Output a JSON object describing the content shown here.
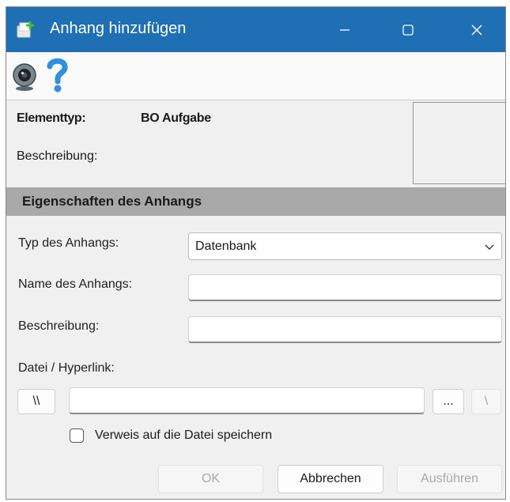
{
  "window": {
    "title": "Anhang hinzufügen"
  },
  "titlebar": {
    "minimize": "minimize-icon",
    "maximize": "maximize-icon",
    "close": "close-icon"
  },
  "toolbar": {
    "icons": [
      "webcam-icon",
      "help-icon"
    ]
  },
  "info": {
    "element_type_label": "Elementtyp:",
    "element_type_value": "BO Aufgabe",
    "description_label": "Beschreibung:"
  },
  "section": {
    "title": "Eigenschaften des Anhangs"
  },
  "form": {
    "type_label": "Typ des Anhangs:",
    "type_value": "Datenbank",
    "name_label": "Name des Anhangs:",
    "name_value": "",
    "description_label": "Beschreibung:",
    "description_value": "",
    "file_label": "Datei / Hyperlink:",
    "file_value": "",
    "unc_button": "\\\\",
    "browse_button": "...",
    "slash_button": "\\",
    "save_reference_label": "Verweis auf die Datei speichern",
    "save_reference_checked": false
  },
  "buttons": {
    "ok": "OK",
    "cancel": "Abbrechen",
    "execute": "Ausführen"
  },
  "colors": {
    "titlebar": "#1f6fb5",
    "section_header": "#a9a9a9",
    "window_bg": "#f0f0f0"
  }
}
